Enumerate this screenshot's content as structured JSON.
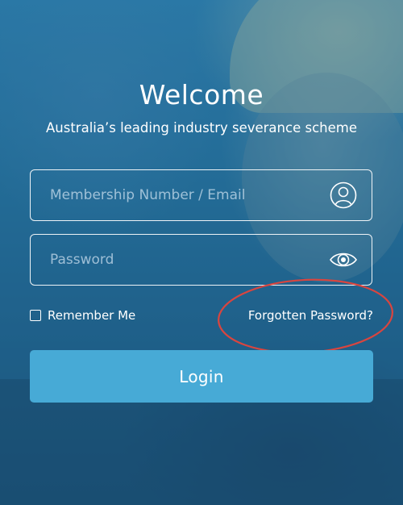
{
  "header": {
    "title": "Welcome",
    "subtitle": "Australia’s leading industry severance scheme"
  },
  "form": {
    "username": {
      "placeholder": "Membership Number / Email",
      "value": "",
      "icon": "user-icon"
    },
    "password": {
      "placeholder": "Password",
      "value": "",
      "icon": "eye-icon"
    },
    "remember_me": {
      "label": "Remember Me",
      "checked": false
    },
    "forgot_password_label": "Forgotten Password?",
    "login_label": "Login"
  },
  "colors": {
    "background": "#236b94",
    "login_button": "#47aad6",
    "text": "#ffffff",
    "annotation_circle": "#d9453f"
  }
}
